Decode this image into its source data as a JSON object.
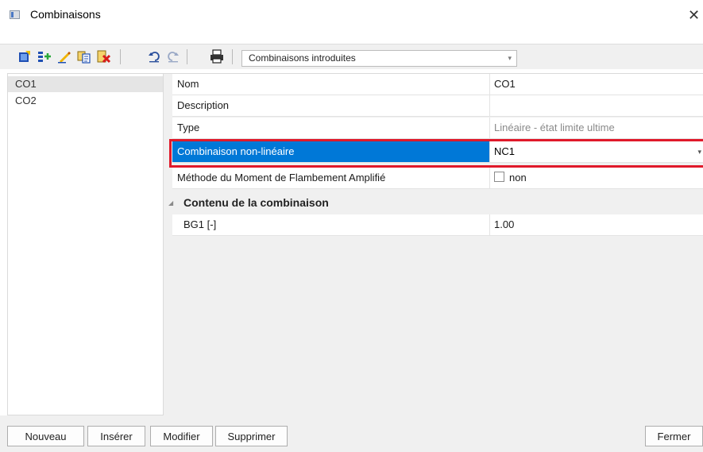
{
  "window": {
    "title": "Combinaisons",
    "close_glyph": "✕"
  },
  "toolbar": {
    "icons": [
      "new-icon",
      "insert-icon",
      "edit-icon",
      "copy-icon",
      "delete-icon",
      "undo-icon",
      "redo-icon",
      "print-icon"
    ],
    "filter_select": {
      "value": "Combinaisons introduites"
    }
  },
  "left_list": {
    "items": [
      {
        "label": "CO1",
        "selected": true
      },
      {
        "label": "CO2",
        "selected": false
      }
    ]
  },
  "properties": {
    "rows": [
      {
        "label": "Nom",
        "value": "CO1"
      },
      {
        "label": "Description",
        "value": ""
      },
      {
        "label": "Type",
        "value": "Linéaire - état limite ultime"
      },
      {
        "label": "Combinaison non-linéaire",
        "value": "NC1"
      },
      {
        "label": "Méthode du Moment de Flambement Amplifié",
        "value": "non"
      }
    ],
    "group": {
      "label": "Contenu de la combinaison",
      "rows": [
        {
          "label": "BG1 [-]",
          "value": "1.00"
        }
      ]
    }
  },
  "buttons": {
    "new": "Nouveau",
    "insert": "Insérer",
    "edit": "Modifier",
    "delete": "Supprimer",
    "close": "Fermer"
  },
  "colors": {
    "selection": "#0078d7",
    "highlight_border": "#e0192a"
  }
}
